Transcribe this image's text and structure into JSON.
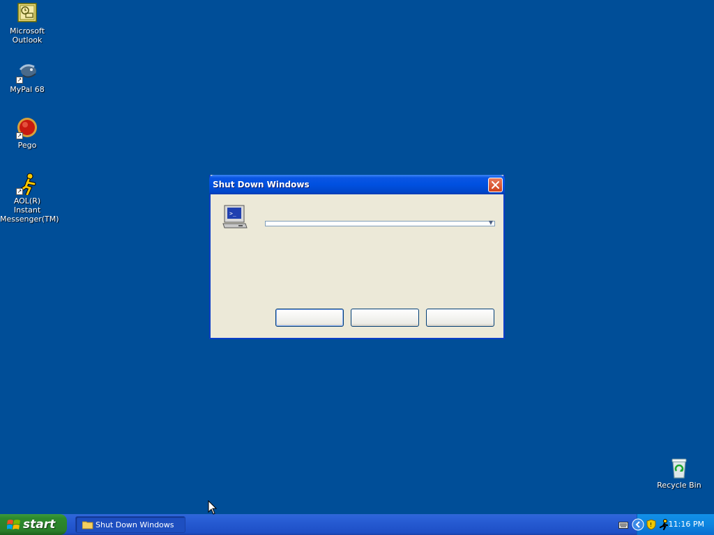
{
  "desktop": {
    "icons": [
      {
        "label": "Microsoft Outlook",
        "icon": "outlook-icon"
      },
      {
        "label": "MyPal 68",
        "icon": "mypal-icon"
      },
      {
        "label": "Pego",
        "icon": "pego-icon"
      },
      {
        "label": "AOL(R) Instant Messenger(TM)",
        "icon": "aim-icon"
      },
      {
        "label": "Recycle Bin",
        "icon": "recycle-bin-icon"
      }
    ],
    "background_color": "#004e98"
  },
  "dialog": {
    "title": "Shut Down Windows",
    "dropdown_value": "",
    "buttons": [
      "",
      "",
      ""
    ]
  },
  "taskbar": {
    "start_label": "start",
    "tasks": [
      {
        "label": "Shut Down Windows"
      }
    ],
    "clock": "11:16 PM"
  }
}
